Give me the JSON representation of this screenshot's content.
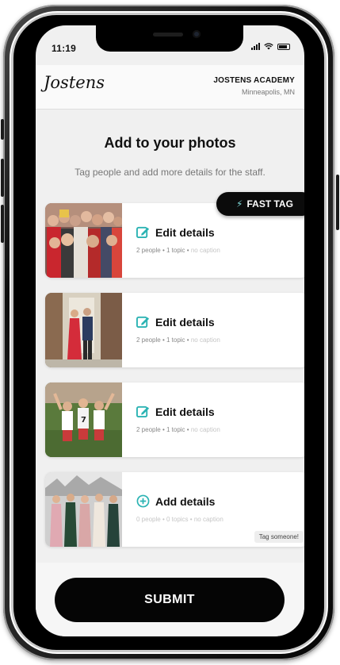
{
  "status_bar": {
    "time": "11:19"
  },
  "header": {
    "logo": "Jostens",
    "school_name": "JOSTENS ACADEMY",
    "school_location": "Minneapolis, MN"
  },
  "intro": {
    "title": "Add to your photos",
    "subtitle": "Tag people and add more details for the staff."
  },
  "fast_tag": {
    "label": "FAST TAG"
  },
  "photos": [
    {
      "action_label": "Edit details",
      "people": "2 people",
      "topics": "1 topic",
      "caption": "no caption"
    },
    {
      "action_label": "Edit details",
      "people": "2 people",
      "topics": "1 topic",
      "caption": "no caption"
    },
    {
      "action_label": "Edit details",
      "people": "2 people",
      "topics": "1 topic",
      "caption": "no caption"
    },
    {
      "action_label": "Add details",
      "people": "0 people",
      "topics": "0 topics",
      "caption": "no caption",
      "tag_label": "Tag someone!"
    }
  ],
  "separator": "•",
  "submit": {
    "label": "SUBMIT"
  },
  "colors": {
    "accent": "#2bb3b3",
    "button": "#050505",
    "background": "#f0f0f0"
  }
}
